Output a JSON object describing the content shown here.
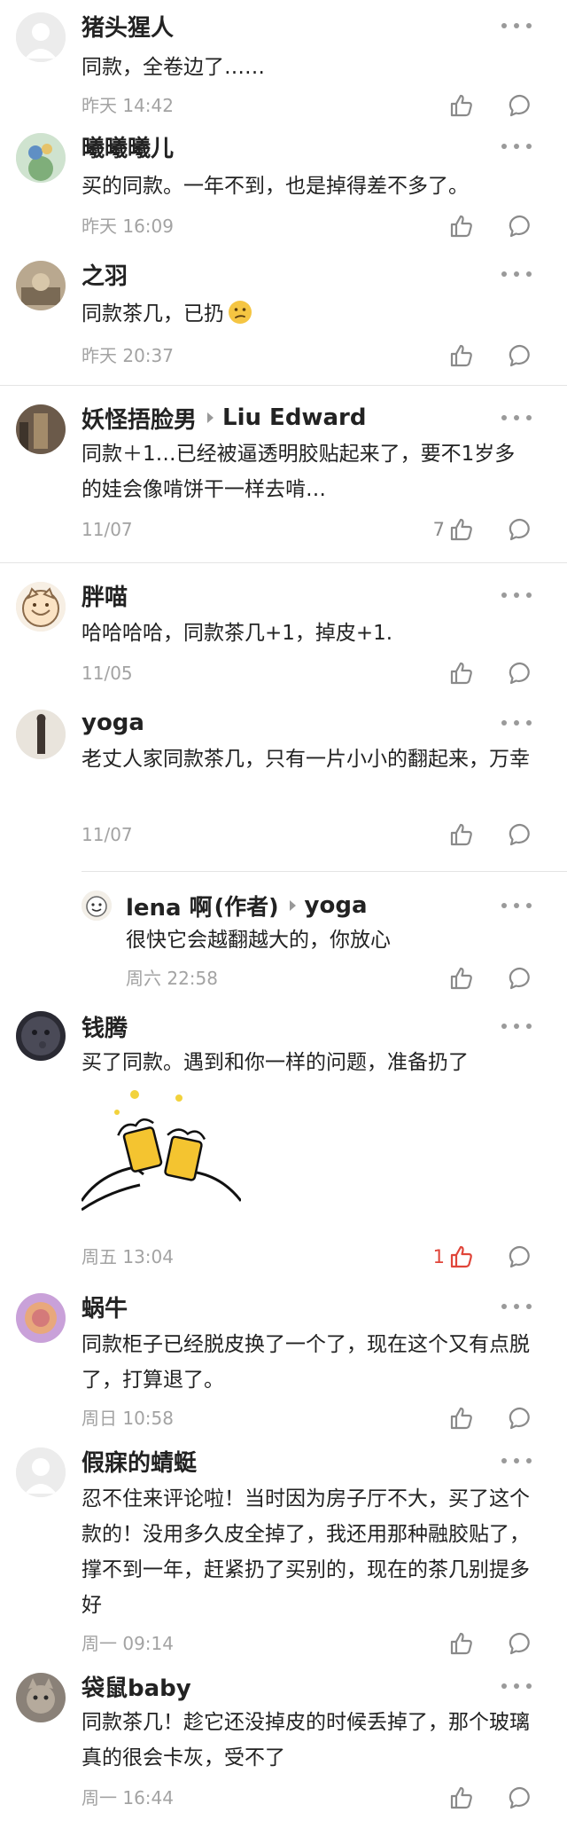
{
  "comments": [
    {
      "user": "猪头猩人",
      "text": "同款，全卷边了……",
      "time": "昨天 14:42",
      "likes": ""
    },
    {
      "user": "曦曦曦儿",
      "text": "买的同款。一年不到，也是掉得差不多了。",
      "time": "昨天 16:09",
      "likes": ""
    },
    {
      "user": "之羽",
      "text": "同款茶几，已扔",
      "emoji": "confused-face",
      "time": "昨天 20:37",
      "likes": ""
    },
    {
      "user": "妖怪捂脸男",
      "reply_to": "Liu Edward",
      "text": "同款＋1…已经被逼透明胶贴起来了，要不1岁多的娃会像啃饼干一样去啃…",
      "time": "11/07",
      "likes": "7"
    },
    {
      "user": "胖喵",
      "text": "哈哈哈哈，同款茶几+1，掉皮+1.",
      "time": "11/05",
      "likes": ""
    },
    {
      "user": "yoga",
      "text": "老丈人家同款茶几，只有一片小小的翻起来，万幸",
      "time": "11/07",
      "likes": ""
    },
    {
      "user": "lena 啊",
      "tag": "(作者)",
      "reply_to": "yoga",
      "text": "很快它会越翻越大的，你放心",
      "time": "周六 22:58",
      "likes": ""
    },
    {
      "user": "钱腾",
      "text": "买了同款。遇到和你一样的问题，准备扔了",
      "sticker": "cheers-beer-sticker",
      "time": "周五 13:04",
      "likes": "1",
      "liked": true
    },
    {
      "user": "蜗牛",
      "text": "同款柜子已经脱皮换了一个了，现在这个又有点脱了，打算退了。",
      "time": "周日 10:58",
      "likes": ""
    },
    {
      "user": "假寐的蜻蜓",
      "text": "忍不住来评论啦！当时因为房子厅不大，买了这个款的！没用多久皮全掉了，我还用那种融胶贴了，撑不到一年，赶紧扔了买别的，现在的茶几别提多好",
      "time": "周一 09:14",
      "likes": ""
    },
    {
      "user": "袋鼠baby",
      "text": "同款茶几！趁它还没掉皮的时候丢掉了，那个玻璃真的很会卡灰，受不了",
      "time": "周一 16:44",
      "likes": ""
    }
  ],
  "colors": {
    "name": "#222222",
    "text": "#222222",
    "meta": "#a3a3a3",
    "icon": "#8a8a8a",
    "liked": "#e0453a",
    "divider": "#e4e4e4"
  },
  "icons": {
    "like": "thumbs-up-icon",
    "reply": "speech-bubble-icon",
    "more": "more-dots-icon"
  }
}
